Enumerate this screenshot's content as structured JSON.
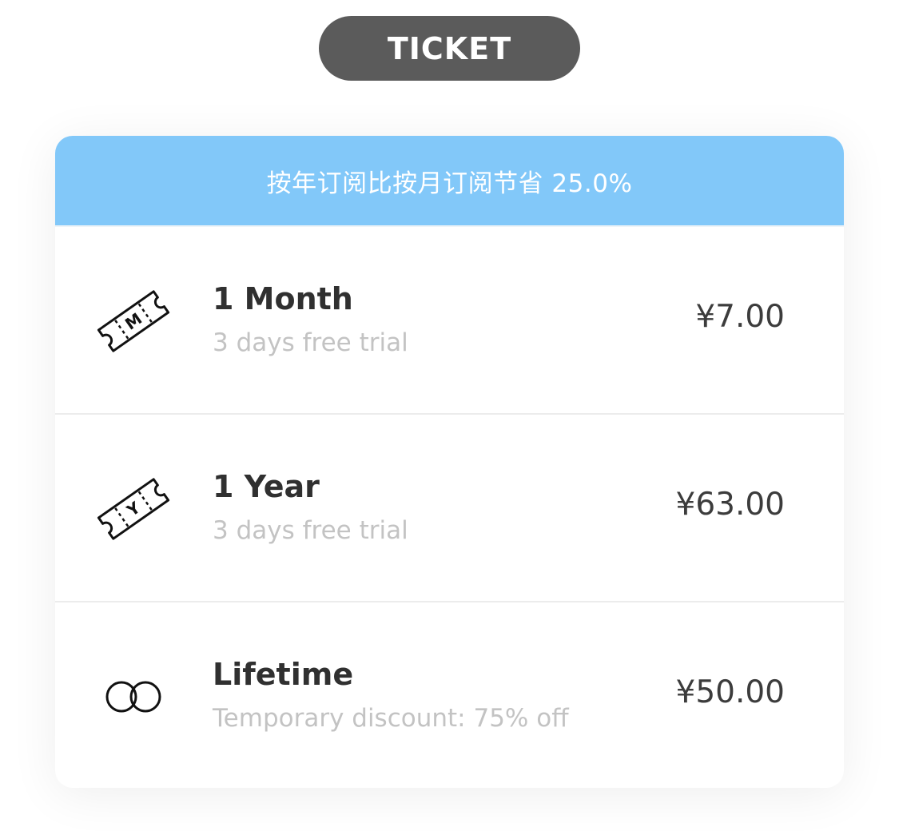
{
  "header": {
    "pill_label": "TICKET"
  },
  "banner": {
    "text": "按年订阅比按月订阅节省 25.0%"
  },
  "plans": [
    {
      "title": "1 Month",
      "subtitle": "3 days free trial",
      "price": "¥7.00",
      "icon": "ticket-icon",
      "icon_letter": "M"
    },
    {
      "title": "1 Year",
      "subtitle": "3 days free trial",
      "price": "¥63.00",
      "icon": "ticket-icon",
      "icon_letter": "Y"
    },
    {
      "title": "Lifetime",
      "subtitle": "Temporary discount: 75% off",
      "price": "¥50.00",
      "icon": "infinity-icon"
    }
  ],
  "colors": {
    "pill_bg": "#5b5b5b",
    "banner_bg": "#82c8f9",
    "title_text": "#303030",
    "subtitle_text": "#c3c3c3",
    "price_text": "#3c3c3c"
  }
}
